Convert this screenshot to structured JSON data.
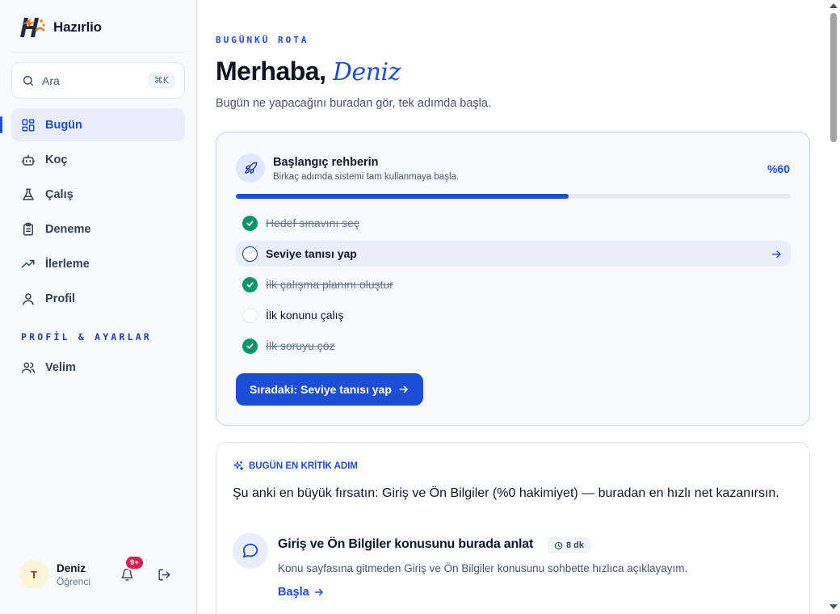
{
  "brand": {
    "name": "Hazırlio"
  },
  "search": {
    "label": "Ara",
    "shortcut": "⌘K"
  },
  "nav": {
    "items": [
      {
        "label": "Bugün",
        "icon": "grid-icon",
        "active": true
      },
      {
        "label": "Koç",
        "icon": "robot-icon"
      },
      {
        "label": "Çalış",
        "icon": "flask-icon"
      },
      {
        "label": "Deneme",
        "icon": "clipboard-icon"
      },
      {
        "label": "İlerleme",
        "icon": "trend-up-icon"
      },
      {
        "label": "Profil",
        "icon": "user-icon"
      }
    ],
    "section_label": "PROFİL & AYARLAR",
    "section_items": [
      {
        "label": "Velim",
        "icon": "users-icon"
      }
    ]
  },
  "user": {
    "initial": "T",
    "name": "Deniz",
    "role": "Öğrenci",
    "notifications": "9+"
  },
  "header": {
    "eyebrow": "BUGÜNKÜ ROTA",
    "greeting": "Merhaba,",
    "name": "Deniz",
    "subtitle": "Bugün ne yapacağını buradan gör, tek adımda başla."
  },
  "onboarding": {
    "title": "Başlangıç rehberin",
    "subtitle": "Birkaç adımda sistemi tam kullanmaya başla.",
    "percent_label": "%60",
    "progress": 0.6,
    "steps": [
      {
        "label": "Hedef sınavını seç",
        "state": "done"
      },
      {
        "label": "Seviye tanısı yap",
        "state": "current"
      },
      {
        "label": "İlk çalışma planını oluştur",
        "state": "done"
      },
      {
        "label": "İlk konunu çalış",
        "state": "pending"
      },
      {
        "label": "İlk soruyu çöz",
        "state": "done"
      }
    ],
    "cta_label": "Sıradaki: Seviye tanısı yap"
  },
  "critical": {
    "heading": "BUGÜN EN KRİTİK ADIM",
    "text": "Şu anki en büyük fırsatın: Giriş ve Ön Bilgiler (%0 hakimiyet) — buradan en hızlı net kazanırsın.",
    "lesson_title": "Giriş ve Ön Bilgiler konusunu burada anlat",
    "duration": "8 dk",
    "lesson_desc": "Konu sayfasına gitmeden Giriş ve Ön Bilgiler konusunu sohbette hızlıca açıklayayım.",
    "start_label": "Başla"
  },
  "colors": {
    "accent": "#1d4ed8",
    "success": "#059669",
    "badge": "#e11d48"
  }
}
